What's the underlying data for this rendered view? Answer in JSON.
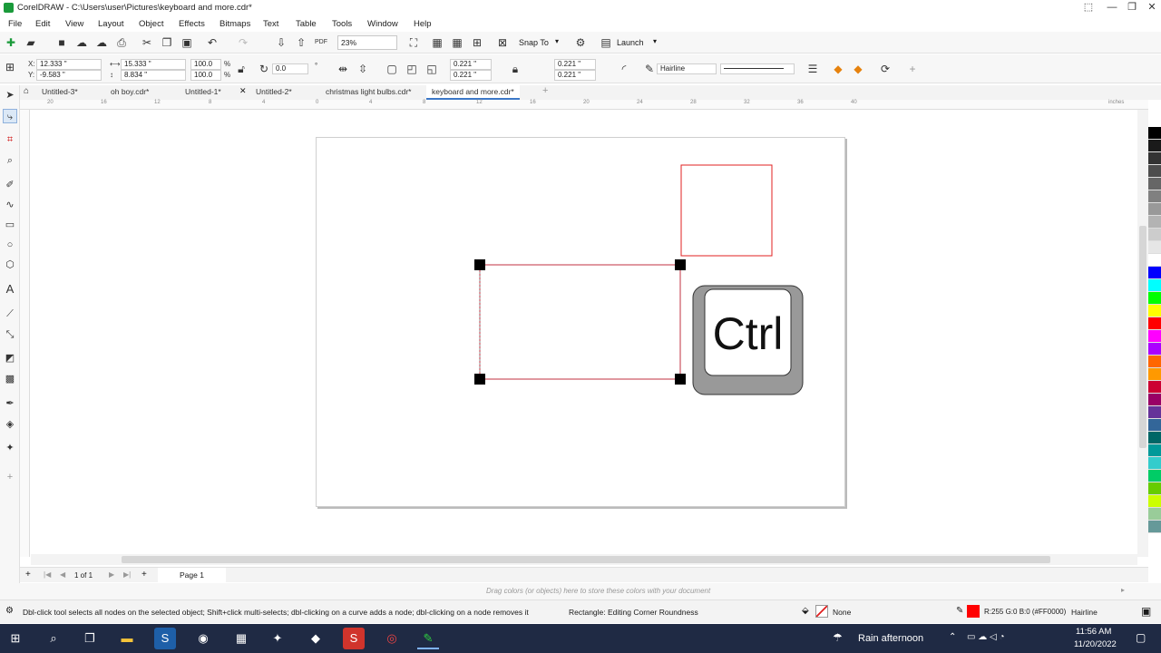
{
  "window": {
    "title": "CorelDRAW - C:\\Users\\user\\Pictures\\keyboard and more.cdr*"
  },
  "menu": [
    "File",
    "Edit",
    "View",
    "Layout",
    "Object",
    "Effects",
    "Bitmaps",
    "Text",
    "Table",
    "Tools",
    "Window",
    "Help"
  ],
  "toolbar": {
    "zoom": "23%",
    "snap_label": "Snap To",
    "launch_label": "Launch",
    "pdf_label": "PDF"
  },
  "props": {
    "x": "12.333 \"",
    "y": "-9.583 \"",
    "width": "15.333 \"",
    "height": "8.834 \"",
    "scale_x": "100.0",
    "scale_y": "100.0",
    "pct": "%",
    "rotation": "0.0",
    "rotation_unit": "°",
    "corner_tl": "0.221 \"",
    "corner_bl": "0.221 \"",
    "corner_tr": "0.221 \"",
    "corner_br": "0.221 \"",
    "outline_width": "Hairline",
    "x_label": "X:",
    "y_label": "Y:"
  },
  "tabs": [
    "Untitled-3*",
    "oh boy.cdr*",
    "Untitled-1*",
    "Untitled-2*",
    "christmas light bulbs.cdr*",
    "keyboard and more.cdr*"
  ],
  "ruler": {
    "h_ticks": [
      "20",
      "16",
      "12",
      "8",
      "4",
      "0",
      "4",
      "8",
      "12",
      "16",
      "20",
      "24",
      "28",
      "32",
      "36",
      "40"
    ],
    "unit": "inches"
  },
  "canvas": {
    "key_text": "Ctrl"
  },
  "pagebar": {
    "page_count": "1 of 1",
    "page_tab": "Page 1"
  },
  "doc_palette_hint": "Drag colors (or objects) here to store these colors with your document",
  "status": {
    "hint": "Dbl-click tool selects all nodes on the selected object; Shift+click multi-selects; dbl-clicking on a curve adds a node; dbl-clicking on a node removes it",
    "object": "Rectangle: Editing Corner Roundness",
    "fill": "None",
    "outline_color": "R:255 G:0 B:0 (#FF0000)",
    "outline_width": "Hairline"
  },
  "taskbar": {
    "weather": "Rain afternoon",
    "time": "11:56 AM",
    "date": "11/20/2022"
  },
  "palette_colors": [
    "#000000",
    "#1a1a1a",
    "#333333",
    "#4d4d4d",
    "#666666",
    "#808080",
    "#999999",
    "#b3b3b3",
    "#cccccc",
    "#e6e6e6",
    "#ffffff",
    "#0000ff",
    "#00ffff",
    "#00ff00",
    "#ffff00",
    "#ff0000",
    "#ff00ff",
    "#aa00ff",
    "#ff6600",
    "#ff9900",
    "#cc0033",
    "#990066",
    "#663399",
    "#336699",
    "#006666",
    "#009999",
    "#33cccc",
    "#00cc66",
    "#66cc00",
    "#ccff00",
    "#99cc99",
    "#669999"
  ]
}
